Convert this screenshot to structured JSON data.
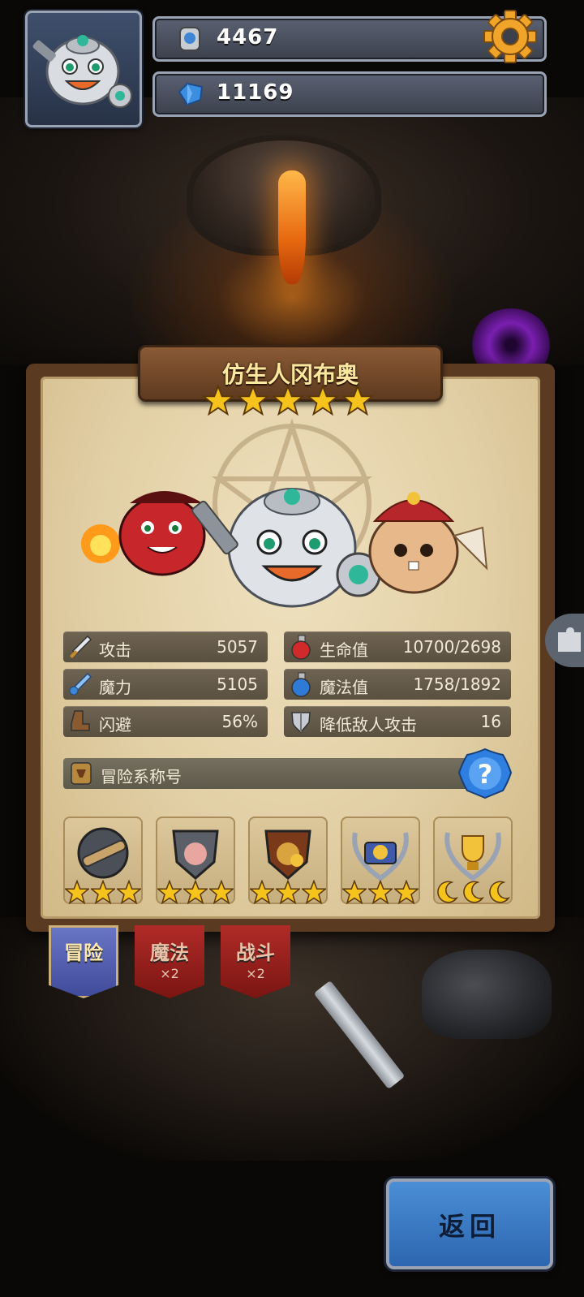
{
  "resources": {
    "gold": "4467",
    "gems": "11169"
  },
  "hero": {
    "name": "仿生人冈布奥",
    "stars": 5
  },
  "stats": {
    "attack": {
      "label": "攻击",
      "value": "5057"
    },
    "hp": {
      "label": "生命值",
      "value": "10700/2698"
    },
    "magic": {
      "label": "魔力",
      "value": "5105"
    },
    "mp": {
      "label": "魔法值",
      "value": "1758/1892"
    },
    "dodge": {
      "label": "闪避",
      "value": "56%"
    },
    "reduce": {
      "label": "降低敌人攻击",
      "value": "16"
    }
  },
  "title_section": {
    "label": "冒险系称号"
  },
  "medals": [
    {
      "icon": "spyglass-medal",
      "stars": 3,
      "star_type": "star"
    },
    {
      "icon": "pig-shield-medal",
      "stars": 3,
      "star_type": "star"
    },
    {
      "icon": "money-bag-medal",
      "stars": 3,
      "star_type": "star"
    },
    {
      "icon": "treasure-laurel-medal",
      "stars": 3,
      "star_type": "star"
    },
    {
      "icon": "trophy-laurel-medal",
      "stars": 3,
      "star_type": "moon"
    }
  ],
  "tabs": [
    {
      "label": "冒险",
      "sub": ""
    },
    {
      "label": "魔法",
      "sub": "×2"
    },
    {
      "label": "战斗",
      "sub": "×2"
    }
  ],
  "back_button": {
    "label": "返回"
  },
  "colors": {
    "gold_star": "#f6c21c",
    "panel_parchment": "#e2cfa5",
    "back_button": "#3a7ac4",
    "tab_active": "#4f5bb0",
    "tab_inactive": "#9a2420"
  }
}
